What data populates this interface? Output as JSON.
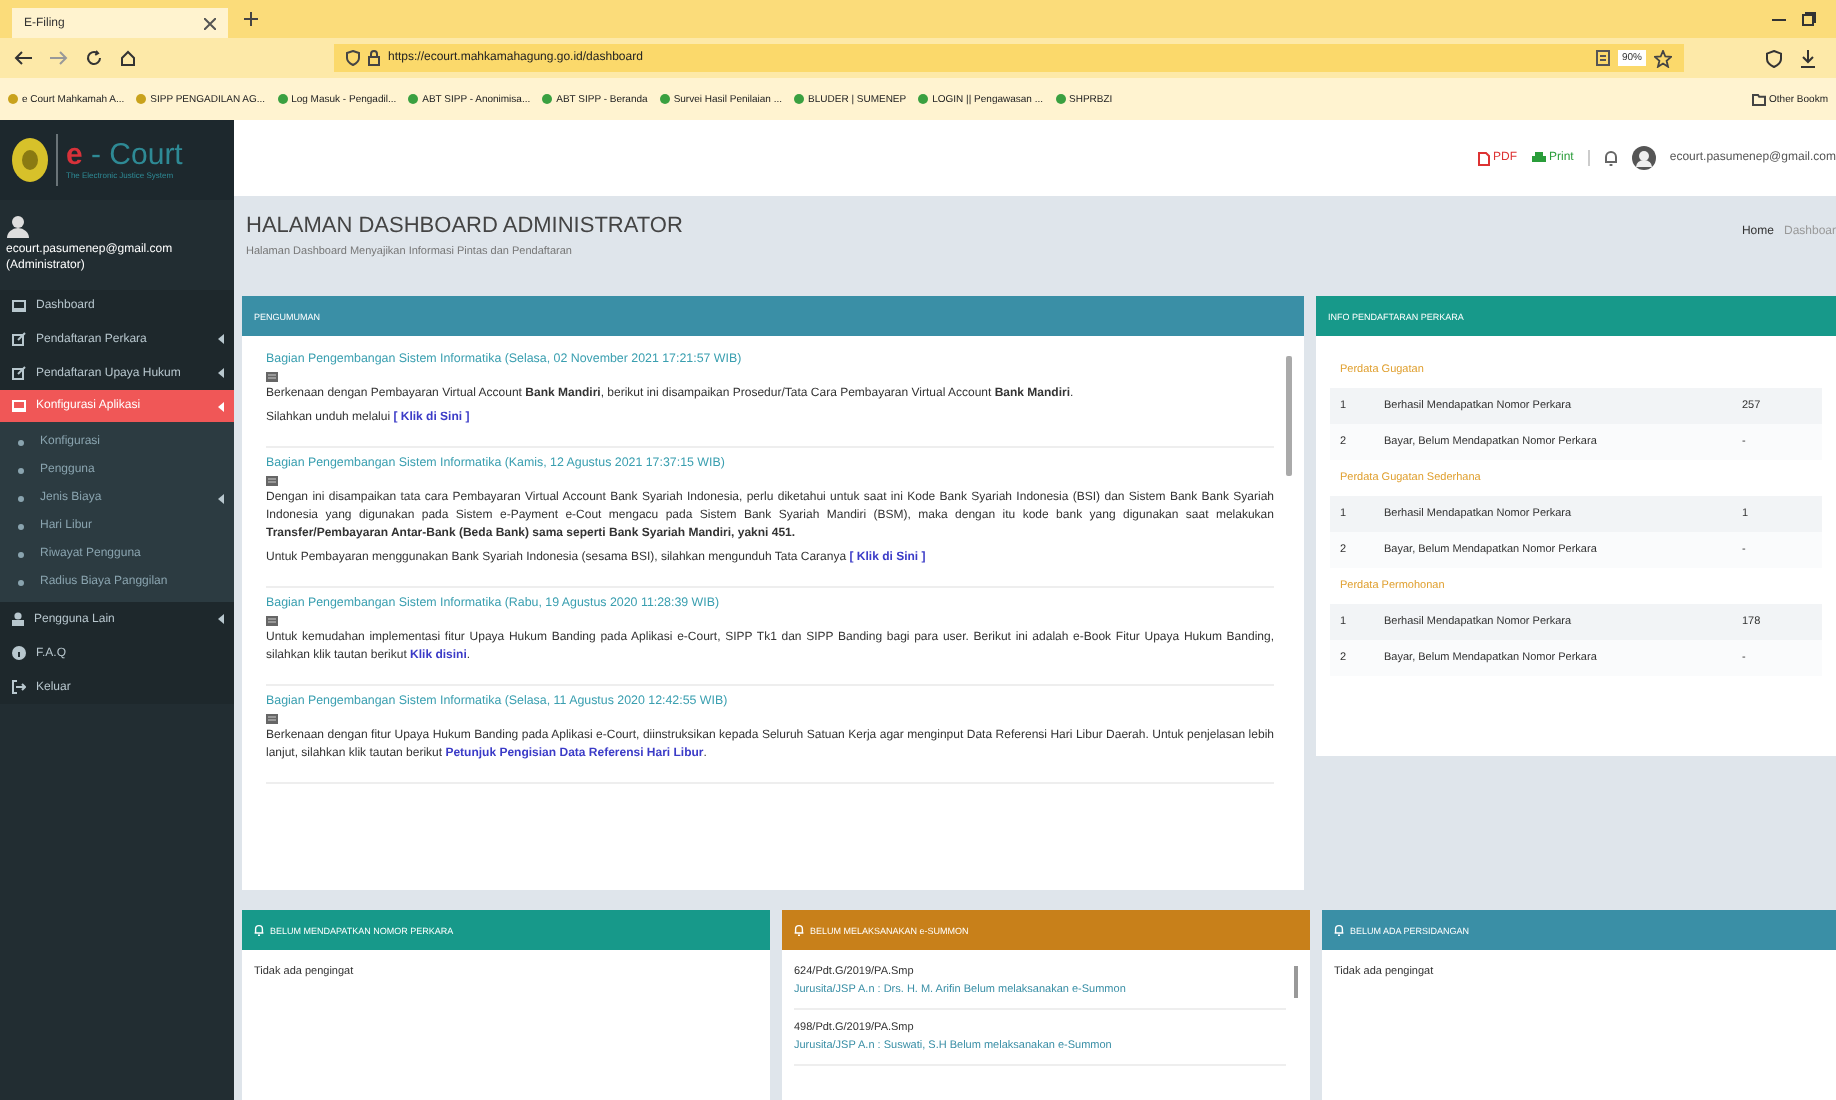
{
  "browser": {
    "tab_title": "E-Filing",
    "url": "https://ecourt.mahkamahagung.go.id/dashboard",
    "zoom": "90%",
    "bookmarks": [
      "e Court Mahkamah A...",
      "SIPP PENGADILAN AG...",
      "Log Masuk - Pengadil...",
      "ABT SIPP - Anonimisa...",
      "ABT SIPP - Beranda",
      "Survei Hasil Penilaian ...",
      "BLUDER | SUMENEP",
      "LOGIN || Pengawasan ...",
      "SHPRBZI"
    ],
    "other_bookmarks": "Other Bookm"
  },
  "logo": {
    "letter": "e",
    "word": "- Court",
    "tagline": "The Electronic Justice System"
  },
  "user": {
    "email": "ecourt.pasumenep@gmail.com",
    "role": "(Administrator)"
  },
  "menu": [
    {
      "label": "Dashboard",
      "selected": false,
      "expandable": false
    },
    {
      "label": "Pendaftaran Perkara",
      "selected": false,
      "expandable": true
    },
    {
      "label": "Pendaftaran Upaya Hukum",
      "selected": false,
      "expandable": true
    },
    {
      "label": "Konfigurasi Aplikasi",
      "selected": true,
      "expandable": true,
      "children": [
        {
          "label": "Konfigurasi",
          "selected": false,
          "expandable": false
        },
        {
          "label": "Pengguna",
          "selected": false,
          "expandable": false
        },
        {
          "label": "Jenis Biaya",
          "selected": false,
          "expandable": true
        },
        {
          "label": "Hari Libur",
          "selected": false,
          "expandable": false
        },
        {
          "label": "Riwayat Pengguna",
          "selected": false,
          "expandable": false
        },
        {
          "label": "Radius Biaya Panggilan",
          "selected": false,
          "expandable": false
        }
      ]
    },
    {
      "label": "Pengguna Lain",
      "selected": false,
      "expandable": true
    },
    {
      "label": "F.A.Q",
      "selected": false,
      "expandable": false
    },
    {
      "label": "Keluar",
      "selected": false,
      "expandable": false
    }
  ],
  "topbar": {
    "pdf": "PDF",
    "print": "Print",
    "email": "ecourt.pasumenep@gmail.com"
  },
  "header": {
    "title": "HALAMAN DASHBOARD ADMINISTRATOR",
    "subtitle": "Halaman Dashboard Menyajikan Informasi Pintas dan Pendaftaran",
    "breadcrumb": [
      "Home",
      "Dashboar"
    ]
  },
  "announcements": {
    "title": "PENGUMUMAN",
    "entries": [
      {
        "title": "Bagian Pengembangan Sistem Informatika (Selasa, 02 November 2021 17:21:57 WIB)",
        "paragraphs": [
          [
            {
              "text": "Berkenaan dengan Pembayaran Virtual Account ",
              "kind": "plain"
            },
            {
              "text": "Bank Mandiri",
              "kind": "bold"
            },
            {
              "text": ", berikut ini disampaikan Prosedur/Tata Cara Pembayaran Virtual Account ",
              "kind": "plain"
            },
            {
              "text": "Bank Mandiri",
              "kind": "bold"
            },
            {
              "text": ".",
              "kind": "plain"
            }
          ],
          [
            {
              "text": "Silahkan unduh melalui ",
              "kind": "plain"
            },
            {
              "text": "[ Klik di Sini ]",
              "kind": "link"
            }
          ]
        ]
      },
      {
        "title": "Bagian Pengembangan Sistem Informatika (Kamis, 12 Agustus 2021 17:37:15 WIB)",
        "paragraphs": [
          [
            {
              "text": "Dengan ini disampaikan tata cara Pembayaran Virtual Account Bank Syariah Indonesia, perlu diketahui untuk saat ini Kode Bank Syariah Indonesia (BSI) dan Sistem Bank Bank Syariah Indonesia yang digunakan pada Sistem e-Payment e-Cout mengacu pada Sistem Bank Syariah Mandiri (BSM), maka dengan itu kode bank yang digunakan saat melakukan ",
              "kind": "plain"
            },
            {
              "text": "Transfer/Pembayaran Antar-Bank (Beda Bank) sama seperti Bank Syariah Mandiri, yakni 451.",
              "kind": "bold"
            }
          ],
          [
            {
              "text": "Untuk Pembayaran menggunakan Bank Syariah Indonesia (sesama BSI), silahkan mengunduh Tata Caranya ",
              "kind": "plain"
            },
            {
              "text": "[ Klik di Sini ]",
              "kind": "link"
            }
          ]
        ]
      },
      {
        "title": "Bagian Pengembangan Sistem Informatika (Rabu, 19 Agustus 2020 11:28:39 WIB)",
        "paragraphs": [
          [
            {
              "text": "Untuk kemudahan implementasi fitur Upaya Hukum Banding pada Aplikasi e-Court, SIPP Tk1 dan SIPP Banding bagi para user. Berikut ini adalah e-Book Fitur Upaya Hukum Banding, silahkan klik tautan berikut ",
              "kind": "plain"
            },
            {
              "text": "Klik disini",
              "kind": "link"
            },
            {
              "text": ".",
              "kind": "plain"
            }
          ]
        ]
      },
      {
        "title": "Bagian Pengembangan Sistem Informatika (Selasa, 11 Agustus 2020 12:42:55 WIB)",
        "paragraphs": [
          [
            {
              "text": "Berkenaan dengan fitur Upaya Hukum Banding pada Aplikasi e-Court, diinstruksikan kepada Seluruh Satuan Kerja agar menginput Data Referensi Hari Libur Daerah. Untuk penjelasan lebih lanjut, silahkan klik tautan berikut ",
              "kind": "plain"
            },
            {
              "text": "Petunjuk Pengisian Data Referensi Hari Libur",
              "kind": "link"
            },
            {
              "text": ".",
              "kind": "plain"
            }
          ]
        ]
      }
    ]
  },
  "info": {
    "title": "INFO PENDAFTARAN PERKARA",
    "groups": [
      {
        "title": "Perdata Gugatan",
        "rows": [
          {
            "no": "1",
            "label": "Berhasil Mendapatkan Nomor Perkara",
            "value": "257"
          },
          {
            "no": "2",
            "label": "Bayar, Belum Mendapatkan Nomor Perkara",
            "value": "-"
          }
        ]
      },
      {
        "title": "Perdata Gugatan Sederhana",
        "rows": [
          {
            "no": "1",
            "label": "Berhasil Mendapatkan Nomor Perkara",
            "value": "1"
          },
          {
            "no": "2",
            "label": "Bayar, Belum Mendapatkan Nomor Perkara",
            "value": "-"
          }
        ]
      },
      {
        "title": "Perdata Permohonan",
        "rows": [
          {
            "no": "1",
            "label": "Berhasil Mendapatkan Nomor Perkara",
            "value": "178"
          },
          {
            "no": "2",
            "label": "Bayar, Belum Mendapatkan Nomor Perkara",
            "value": "-"
          }
        ]
      }
    ]
  },
  "reminders": [
    {
      "title": "BELUM MENDAPATKAN NOMOR PERKARA",
      "color": "#17998a",
      "message": "Tidak ada pengingat"
    },
    {
      "title": "BELUM MELAKSANAKAN e-SUMMON",
      "color": "#c8801a",
      "items": [
        {
          "case": "624/Pdt.G/2019/PA.Smp",
          "text": "Jurusita/JSP A.n : Drs. H. M. Arifin Belum melaksanakan e-Summon"
        },
        {
          "case": "498/Pdt.G/2019/PA.Smp",
          "text": "Jurusita/JSP A.n : Suswati, S.H Belum melaksanakan e-Summon"
        }
      ]
    },
    {
      "title": "BELUM ADA PERSIDANGAN",
      "color": "#3a8fa6",
      "message": "Tidak ada pengingat"
    }
  ]
}
